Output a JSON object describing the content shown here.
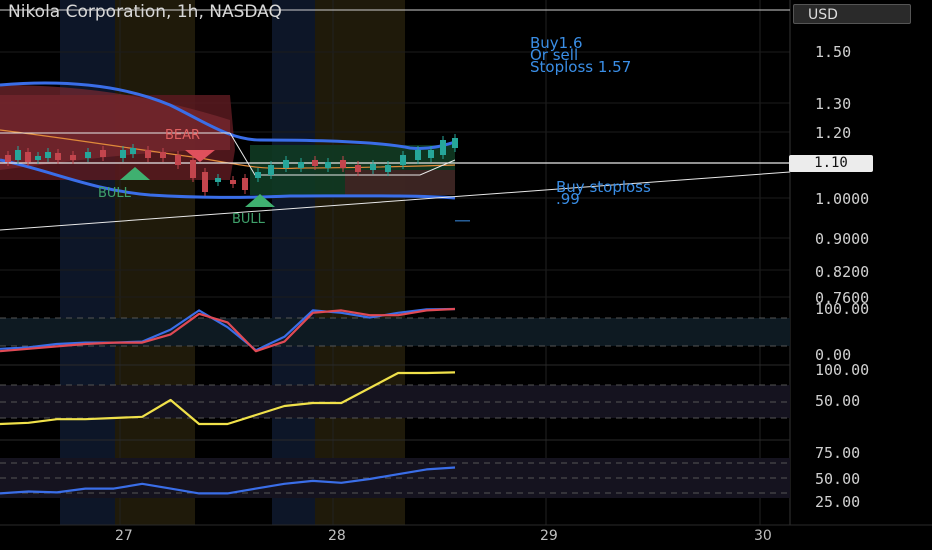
{
  "header": {
    "title": "Nikola Corporation, 1h, NASDAQ",
    "currency": "USD"
  },
  "notes": {
    "top": [
      "Buy1.6",
      "Or sell",
      "Stoploss 1.57"
    ],
    "bottom": [
      "Buy stoploss",
      ".99"
    ]
  },
  "signals": {
    "bear": "BEAR",
    "bull1": "BULL",
    "bull2": "BULL"
  },
  "price_tag": "1.10",
  "axes": {
    "price_ticks": [
      "1.50",
      "1.30",
      "1.20",
      "1.00",
      "1.0000",
      "0.9000",
      "0.8200",
      "0.7600"
    ],
    "stoch_ticks": [
      "100.00",
      "0.00"
    ],
    "osc2_ticks": [
      "100.00",
      "50.00"
    ],
    "osc3_ticks": [
      "75.00",
      "50.00",
      "25.00"
    ],
    "x_ticks": [
      "27",
      "28",
      "29",
      "30"
    ]
  },
  "colors": {
    "blue": "#3a6ee8",
    "red": "#e04a55",
    "yellow": "#f0e14a",
    "green": "#26a69a",
    "bear_red": "#c3454d"
  },
  "chart_data": {
    "type": "line",
    "title": "Nikola Corporation, 1h, NASDAQ",
    "x_categories": [
      "27",
      "28",
      "29",
      "30"
    ],
    "price_ylim": [
      0.76,
      1.5
    ],
    "levels": {
      "current_price": 1.1,
      "buy": 1.6,
      "stoploss": 1.57,
      "buy_stoploss": 0.99
    },
    "panels": [
      {
        "name": "",
        "ylim": [
          0,
          100
        ],
        "series": [
          {
            "color": "#3a6ee8",
            "values": [
              15,
              18,
              25,
              28,
              28,
              30,
              55,
              95,
              60,
              12,
              40,
              95,
              90,
              80,
              90,
              97,
              98
            ]
          },
          {
            "color": "#e04a55",
            "values": [
              10,
              15,
              20,
              25,
              28,
              28,
              45,
              88,
              70,
              10,
              30,
              90,
              95,
              85,
              85,
              95,
              98
            ]
          }
        ]
      },
      {
        "name": "",
        "ylim": [
          0,
          100
        ],
        "series": [
          {
            "color": "#f0e14a",
            "values": [
              10,
              12,
              18,
              18,
              20,
              22,
              50,
              10,
              10,
              25,
              40,
              45,
              45,
              70,
              95,
              95,
              96
            ]
          }
        ]
      },
      {
        "name": "",
        "ylim": [
          25,
          75
        ],
        "series": [
          {
            "color": "#3a6ee8",
            "values": [
              35,
              37,
              36,
              40,
              40,
              45,
              40,
              35,
              35,
              40,
              45,
              48,
              46,
              50,
              55,
              60,
              62
            ]
          }
        ]
      }
    ]
  }
}
